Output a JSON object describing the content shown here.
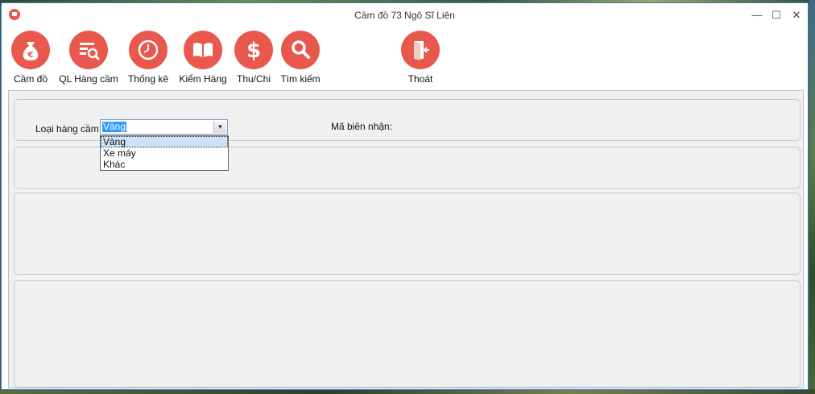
{
  "window": {
    "title": "Cầm đồ 73 Ngô Sĩ Liên",
    "controls": {
      "minimize": "—",
      "maximize": "☐",
      "close": "✕"
    }
  },
  "toolbar": {
    "items": [
      {
        "label": "Cầm đồ",
        "icon": "money-bag-icon"
      },
      {
        "label": "QL Hàng cầm",
        "icon": "search-list-icon"
      },
      {
        "label": "Thống kê",
        "icon": "clock-icon"
      },
      {
        "label": "Kiểm Hàng",
        "icon": "book-icon"
      },
      {
        "label": "Thu/Chi",
        "icon": "dollar-icon"
      },
      {
        "label": "Tìm kiếm",
        "icon": "search-icon"
      },
      {
        "label": "Thoát",
        "icon": "exit-door-icon"
      }
    ]
  },
  "form": {
    "loai_hang_label": "Loại hàng cầm",
    "loai_hang_value": "Vàng",
    "options": [
      "Vàng",
      "Xe máy",
      "Khác"
    ],
    "ma_bien_nhan_label": "Mã biên nhận:"
  },
  "colors": {
    "accent": "#e8584d",
    "selection": "#3399ff"
  }
}
